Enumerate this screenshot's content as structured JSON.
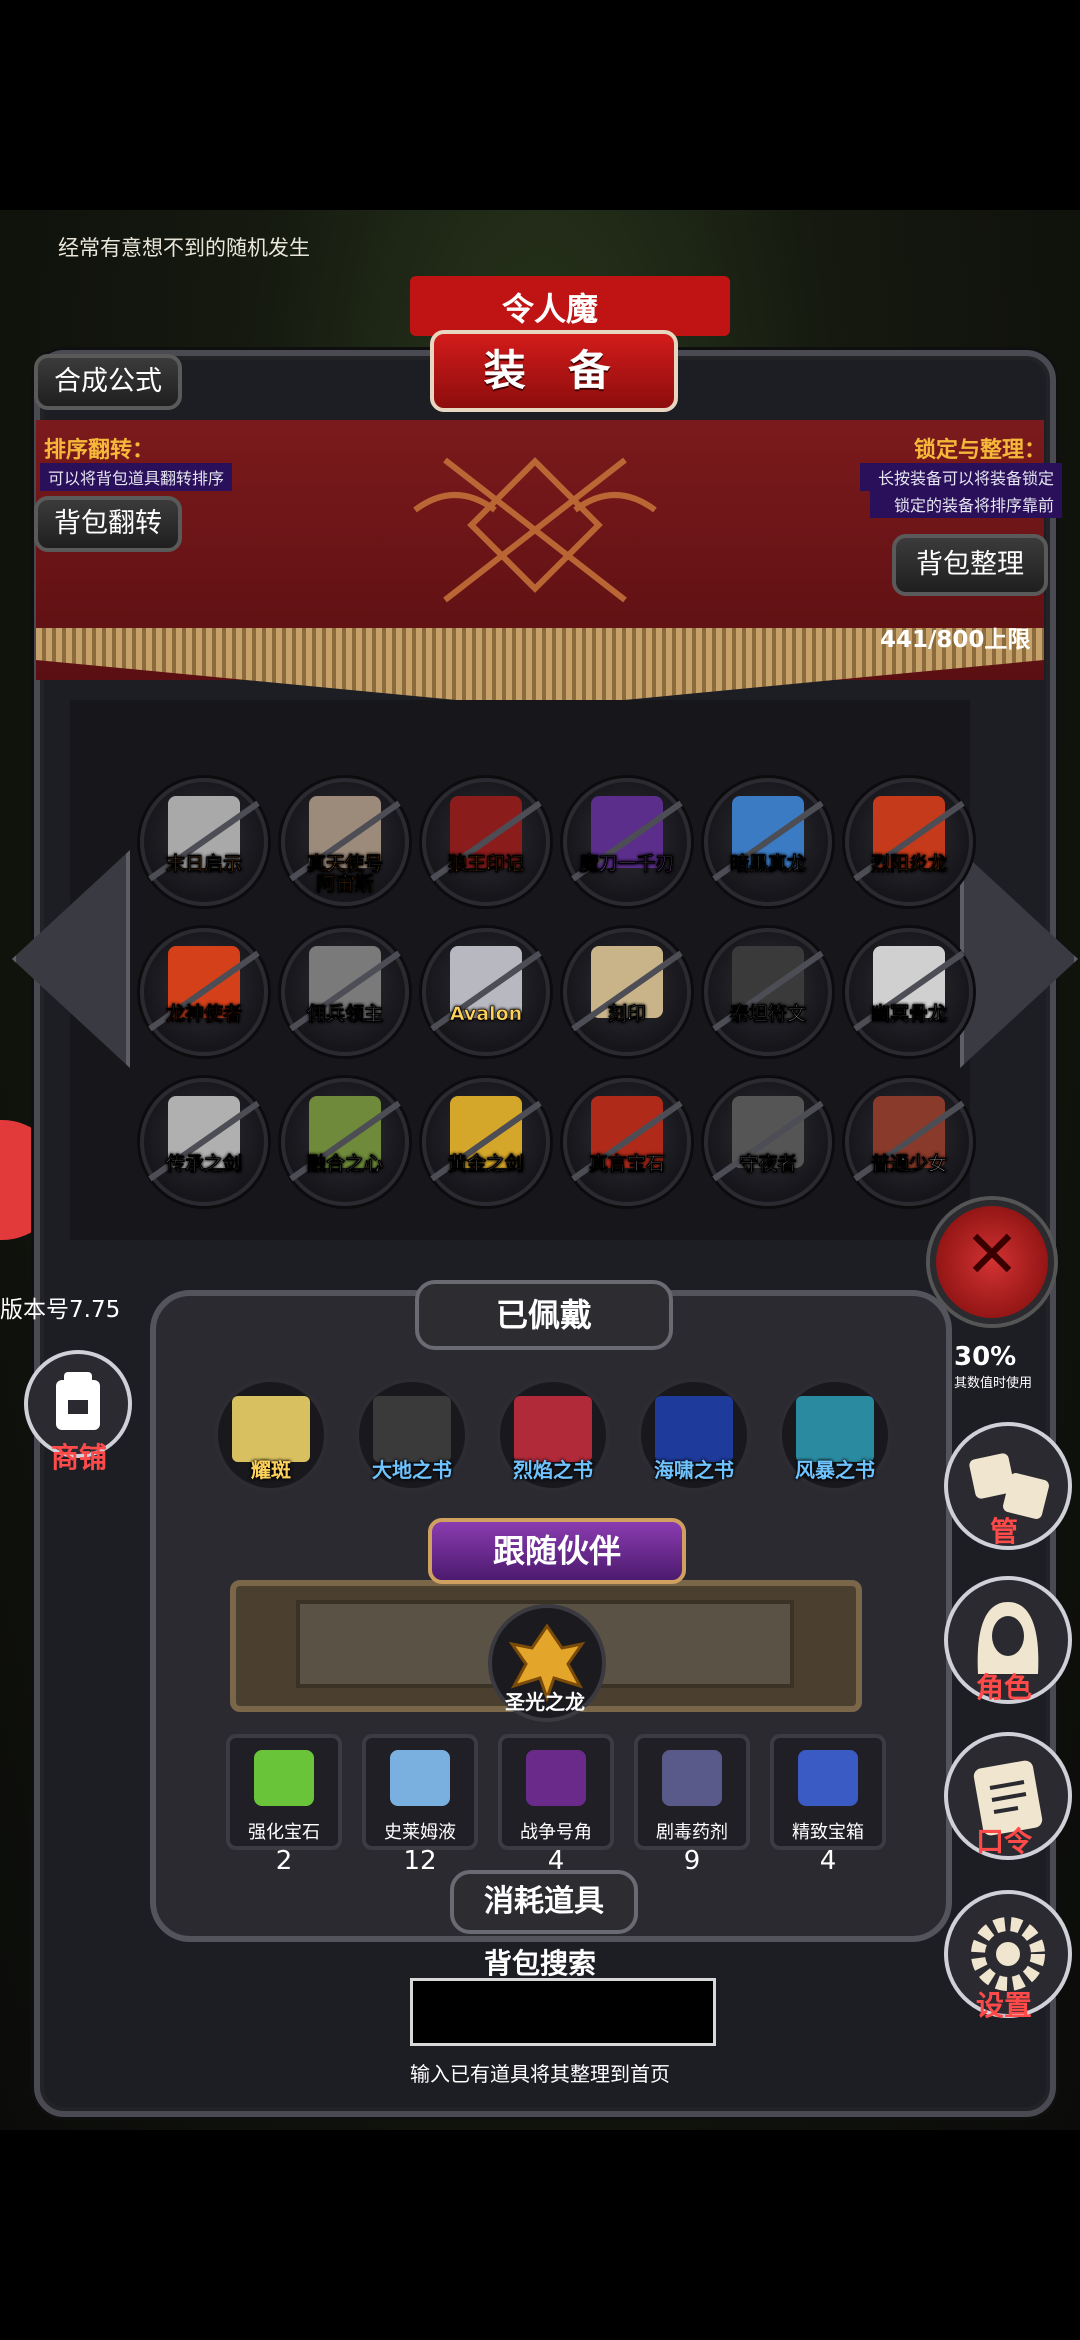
{
  "top_tip": "经常有意想不到的随机发生",
  "header": {
    "ribbon_text": "令人魔",
    "title": "装 备"
  },
  "left_buttons": {
    "formula": "合成公式",
    "flip": "背包翻转"
  },
  "sort_info": {
    "label": "排序翻转：",
    "desc": "可以将背包道具翻转排序"
  },
  "lock_info": {
    "label": "锁定与整理：",
    "desc1": "长按装备可以将装备锁定",
    "desc2": "锁定的装备将排序靠前"
  },
  "sort_button": "背包整理",
  "capacity": "441/800上限",
  "items": [
    {
      "name": "末日启示",
      "color": "#ff8a1e"
    },
    {
      "name": "真天使号\n阿宙斯",
      "color": "#ff8a1e"
    },
    {
      "name": "狼王印记",
      "color": "#ff8a1e"
    },
    {
      "name": "魔刀一千刃",
      "color": "#c890ff"
    },
    {
      "name": "暗黑真龙",
      "color": "#ffffff"
    },
    {
      "name": "烈阳炎龙",
      "color": "#ff8a1e"
    },
    {
      "name": "龙神使者",
      "color": "#ff3b2e"
    },
    {
      "name": "佣兵领主",
      "color": "#ffffff"
    },
    {
      "name": "Avalon",
      "color": "#ffd25a"
    },
    {
      "name": "刻印",
      "color": "#ffffff"
    },
    {
      "name": "泰坦符文",
      "color": "#ffffff"
    },
    {
      "name": "幽冥骨龙",
      "color": "#ffffff"
    },
    {
      "name": "传承之剑",
      "color": "#ffffff"
    },
    {
      "name": "融合之心",
      "color": "#ffffff"
    },
    {
      "name": "黄金之剑",
      "color": "#ffffff"
    },
    {
      "name": "真言宝石",
      "color": "#ffffff"
    },
    {
      "name": "守夜者",
      "color": "#ffffff"
    },
    {
      "name": "普通少女",
      "color": "#ffffff"
    }
  ],
  "version": "版本号7.75",
  "shop_label": "商铺",
  "worn": {
    "title": "已佩戴",
    "items": [
      {
        "name": "耀斑",
        "color": "#ffd25a"
      },
      {
        "name": "大地之书",
        "color": "#6fc3ff"
      },
      {
        "name": "烈焰之书",
        "color": "#6fc3ff"
      },
      {
        "name": "海啸之书",
        "color": "#6fc3ff"
      },
      {
        "name": "风暴之书",
        "color": "#6fc3ff"
      }
    ]
  },
  "companion": {
    "title": "跟随伙伴",
    "name": "圣光之龙"
  },
  "consumables": {
    "title": "消耗道具",
    "items": [
      {
        "name": "强化宝石",
        "count": "2"
      },
      {
        "name": "史莱姆液",
        "count": "12"
      },
      {
        "name": "战争号角",
        "count": "4"
      },
      {
        "name": "剧毒药剂",
        "count": "9"
      },
      {
        "name": "精致宝箱",
        "count": "4"
      }
    ]
  },
  "search": {
    "label": "背包搜索",
    "hint": "输入已有道具将其整理到首页",
    "value": ""
  },
  "side_menu": {
    "partial_top_text": "30%",
    "partial_top_note": "其数值时使用",
    "manage": "管",
    "role": "角色",
    "code": "口令",
    "settings": "设置"
  }
}
